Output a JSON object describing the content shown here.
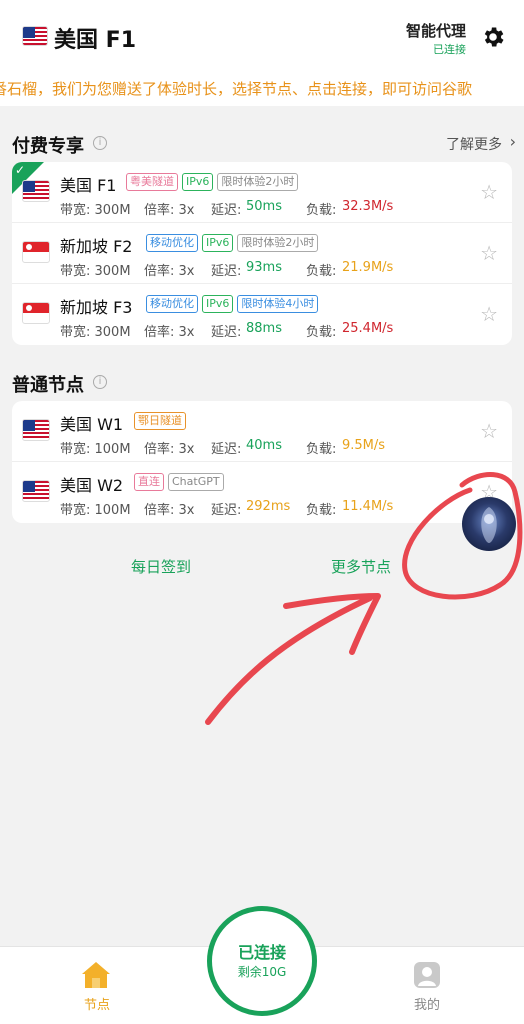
{
  "header": {
    "title": "美国 F1",
    "proxy_mode": "智能代理",
    "proxy_status": "已连接"
  },
  "marquee": "番石榴，我们为您赠送了体验时长，选择节点、点击连接，即可访问谷歌",
  "paid_section": {
    "title": "付费专享",
    "learn_more": "了解更多",
    "nodes": [
      {
        "name": "美国 F1",
        "flag": "us",
        "tags": [
          "粤美隧道",
          "IPv6",
          "限时体验2小时"
        ],
        "bandwidth_label": "带宽: 300M",
        "rate_label": "倍率: 3x",
        "latency_label": "延迟:",
        "latency": "50ms",
        "load_label": "负载:",
        "load": "32.3M/s",
        "selected": true
      },
      {
        "name": "新加坡 F2",
        "flag": "sg",
        "tags": [
          "移动优化",
          "IPv6",
          "限时体验2小时"
        ],
        "bandwidth_label": "带宽: 300M",
        "rate_label": "倍率: 3x",
        "latency_label": "延迟:",
        "latency": "93ms",
        "load_label": "负载:",
        "load": "21.9M/s"
      },
      {
        "name": "新加坡 F3",
        "flag": "sg",
        "tags": [
          "移动优化",
          "IPv6",
          "限时体验4小时"
        ],
        "bandwidth_label": "带宽: 300M",
        "rate_label": "倍率: 3x",
        "latency_label": "延迟:",
        "latency": "88ms",
        "load_label": "负载:",
        "load": "25.4M/s"
      }
    ]
  },
  "normal_section": {
    "title": "普通节点",
    "nodes": [
      {
        "name": "美国 W1",
        "flag": "us",
        "tags": [
          "鄂日隧道"
        ],
        "bandwidth_label": "带宽: 100M",
        "rate_label": "倍率: 3x",
        "latency_label": "延迟:",
        "latency": "40ms",
        "load_label": "负载:",
        "load": "9.5M/s"
      },
      {
        "name": "美国 W2",
        "flag": "us",
        "tags": [
          "直连",
          "ChatGPT"
        ],
        "bandwidth_label": "带宽: 100M",
        "rate_label": "倍率: 3x",
        "latency_label": "延迟:",
        "latency": "292ms",
        "load_label": "负载:",
        "load": "11.4M/s"
      }
    ]
  },
  "links": {
    "daily_checkin": "每日签到",
    "more_nodes": "更多节点"
  },
  "bottom_nav": {
    "nodes_tab": "节点",
    "me_tab": "我的",
    "connect_status": "已连接",
    "connect_remaining": "剩余10G"
  },
  "colors": {
    "accent_green": "#19a25a",
    "marquee_orange": "#e8921a",
    "annotation_red": "#e8474f"
  }
}
